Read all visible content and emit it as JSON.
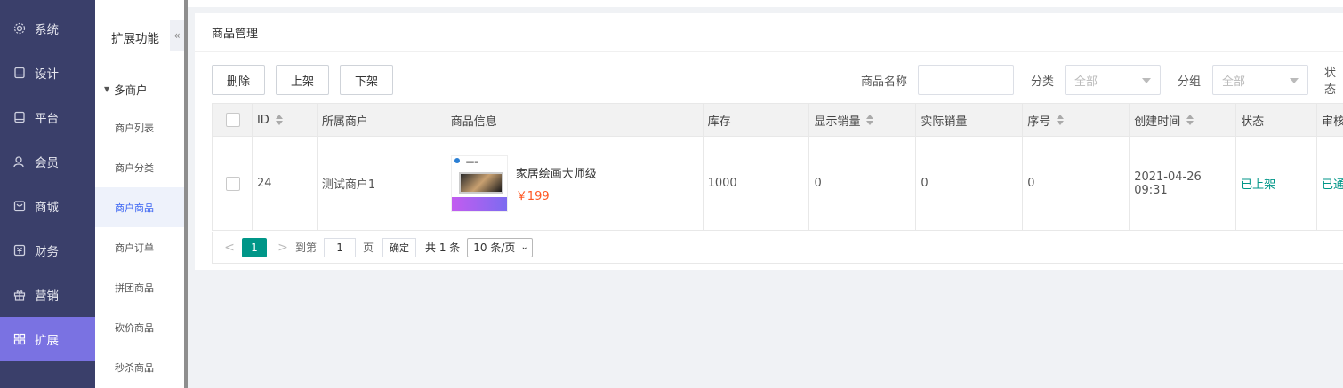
{
  "nav": {
    "items": [
      {
        "label": "系统",
        "icon": "gear-icon"
      },
      {
        "label": "设计",
        "icon": "design-icon"
      },
      {
        "label": "平台",
        "icon": "platform-icon"
      },
      {
        "label": "会员",
        "icon": "user-icon"
      },
      {
        "label": "商城",
        "icon": "store-icon"
      },
      {
        "label": "财务",
        "icon": "finance-icon"
      },
      {
        "label": "营销",
        "icon": "gift-icon"
      },
      {
        "label": "扩展",
        "icon": "grid-icon"
      }
    ],
    "active_index": 7
  },
  "subnav": {
    "title": "扩展功能",
    "collapse_icon": "«",
    "group": "多商户",
    "items": [
      "商户列表",
      "商户分类",
      "商户商品",
      "商户订单",
      "拼团商品",
      "砍价商品",
      "秒杀商品"
    ],
    "active_index": 2
  },
  "page": {
    "title": "商品管理"
  },
  "toolbar": {
    "delete_label": "删除",
    "onshelf_label": "上架",
    "offshelf_label": "下架"
  },
  "filters": {
    "name_label": "商品名称",
    "name_value": "",
    "category_label": "分类",
    "category_value": "全部",
    "group_label": "分组",
    "group_value": "全部",
    "status_label": "状态"
  },
  "table": {
    "columns": [
      "ID",
      "所属商户",
      "商品信息",
      "库存",
      "显示销量",
      "实际销量",
      "序号",
      "创建时间",
      "状态",
      "审核"
    ],
    "rows": [
      {
        "id": "24",
        "merchant": "测试商户1",
        "product_name": "家居绘画大师级",
        "price": "￥199",
        "stock": "1000",
        "display_sales": "0",
        "actual_sales": "0",
        "order": "0",
        "created": "2021-04-26 09:31",
        "status": "已上架",
        "audit": "已通"
      }
    ]
  },
  "pager": {
    "prev": "<",
    "current": "1",
    "next": ">",
    "goto_label": "到第",
    "goto_value": "1",
    "page_unit": "页",
    "confirm": "确定",
    "total": "共 1 条",
    "page_size": "10 条/页"
  },
  "colors": {
    "nav_bg": "#3a3f6a",
    "nav_active": "#7a72e2",
    "accent": "#009688",
    "price": "#ff5722"
  }
}
